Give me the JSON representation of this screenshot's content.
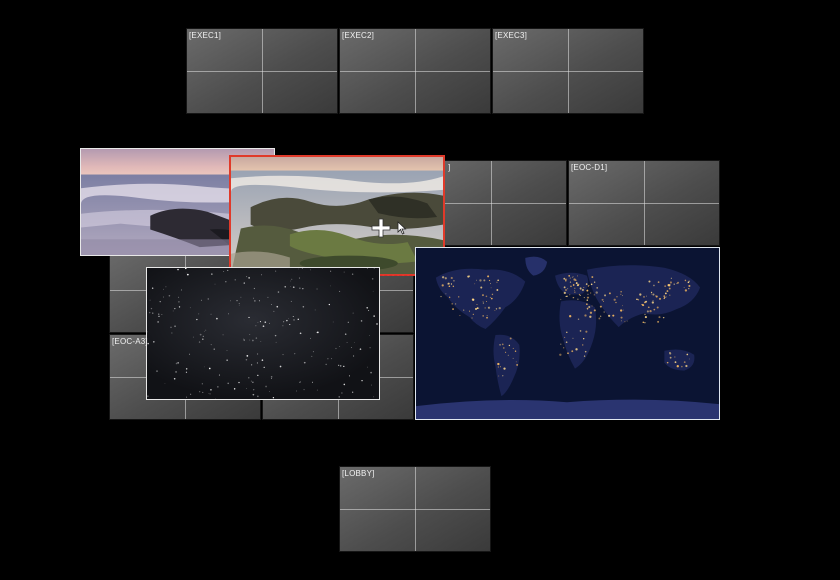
{
  "displays": [
    {
      "id": "exec1",
      "label": "[EXEC1]"
    },
    {
      "id": "exec2",
      "label": "[EXEC2]"
    },
    {
      "id": "exec3",
      "label": "[EXEC3]"
    },
    {
      "id": "eoc-c1",
      "label": "]"
    },
    {
      "id": "eoc-d1",
      "label": "[EOC-D1]"
    },
    {
      "id": "eoc-a3",
      "label": "[EOC-A3]"
    },
    {
      "id": "lobby",
      "label": "[LOBBY]"
    }
  ],
  "windows": [
    {
      "id": "beach-sunset",
      "content": "beach-sunset-image"
    },
    {
      "id": "rocky-shore",
      "content": "rocky-shore-image",
      "selected": true
    },
    {
      "id": "starfield",
      "content": "starfield-image"
    },
    {
      "id": "world-night",
      "content": "earth-at-night-image"
    }
  ],
  "colors": {
    "background": "#000000",
    "selection_border": "#e03a2a",
    "window_border": "#e8e8e8",
    "label_text": "#f2f2f2"
  },
  "cursor": {
    "icon": "move-cursor-icon"
  }
}
